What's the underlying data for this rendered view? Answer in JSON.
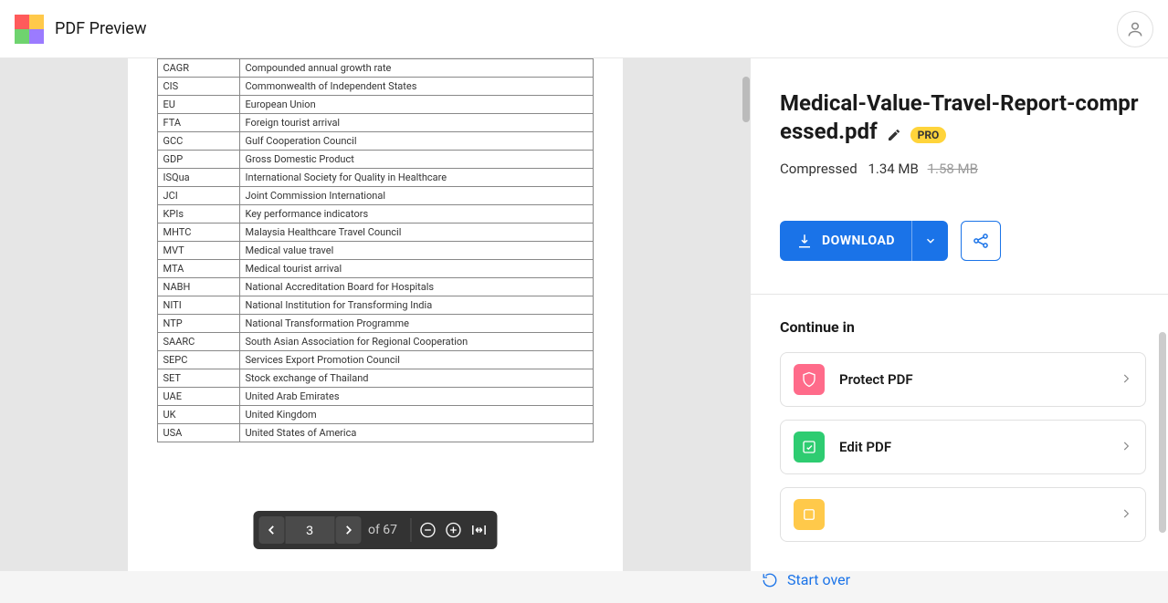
{
  "header": {
    "brand": "PDF Preview"
  },
  "viewer": {
    "current_page": "3",
    "total_pages_label": "of 67",
    "table_rows": [
      {
        "abbr": "CAGR",
        "def": "Compounded annual growth rate"
      },
      {
        "abbr": "CIS",
        "def": "Commonwealth of Independent States"
      },
      {
        "abbr": "EU",
        "def": "European Union"
      },
      {
        "abbr": "FTA",
        "def": "Foreign tourist arrival"
      },
      {
        "abbr": "GCC",
        "def": "Gulf Cooperation Council"
      },
      {
        "abbr": "GDP",
        "def": "Gross Domestic Product"
      },
      {
        "abbr": "ISQua",
        "def": "International Society for Quality in Healthcare"
      },
      {
        "abbr": "JCI",
        "def": "Joint Commission International"
      },
      {
        "abbr": "KPIs",
        "def": "Key performance indicators"
      },
      {
        "abbr": "MHTC",
        "def": "Malaysia Healthcare Travel Council"
      },
      {
        "abbr": "MVT",
        "def": "Medical value travel"
      },
      {
        "abbr": "MTA",
        "def": "Medical tourist arrival"
      },
      {
        "abbr": "NABH",
        "def": "National Accreditation Board for Hospitals"
      },
      {
        "abbr": "NITI",
        "def": "National Institution for Transforming India"
      },
      {
        "abbr": "NTP",
        "def": "National Transformation Programme"
      },
      {
        "abbr": "SAARC",
        "def": "South Asian Association for Regional Cooperation"
      },
      {
        "abbr": "SEPC",
        "def": "Services Export Promotion Council"
      },
      {
        "abbr": "SET",
        "def": "Stock exchange of Thailand"
      },
      {
        "abbr": "UAE",
        "def": "United Arab Emirates"
      },
      {
        "abbr": "UK",
        "def": "United Kingdom"
      },
      {
        "abbr": "USA",
        "def": "United States of America"
      }
    ]
  },
  "sidebar": {
    "file_name": "Medical-Value-Travel-Report-compressed.pdf",
    "pro_badge": "PRO",
    "status_label": "Compressed",
    "new_size": "1.34 MB",
    "old_size": "1.58 MB",
    "download_label": "DOWNLOAD",
    "continue_label": "Continue in",
    "actions": [
      {
        "label": "Protect PDF",
        "color": "pink",
        "icon": "shield"
      },
      {
        "label": "Edit PDF",
        "color": "green",
        "icon": "edit"
      },
      {
        "label": "",
        "color": "yellow",
        "icon": "generic"
      }
    ],
    "start_over": "Start over"
  }
}
